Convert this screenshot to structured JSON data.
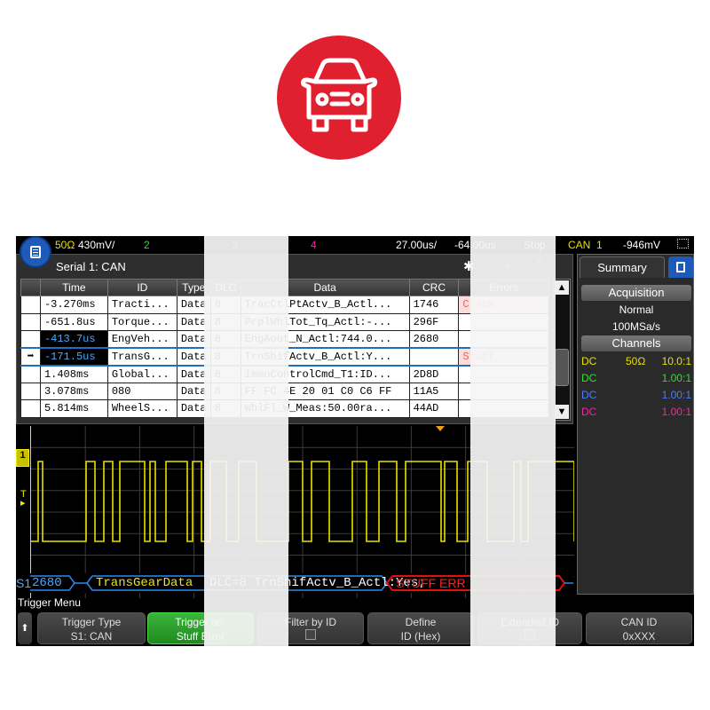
{
  "logo": {
    "icon": "car-icon",
    "color": "#e0202e"
  },
  "topbar": {
    "ch1_imp": "50Ω",
    "ch1_scale": "430mV/",
    "ch2": "2",
    "ch3": "3",
    "ch4": "4",
    "timebase": "27.00us/",
    "delay": "-64.00us",
    "run_state": "Stop",
    "trigger_type": "CAN",
    "trigger_source": "1",
    "trigger_level": "-946mV"
  },
  "serial": {
    "title": "Serial 1: CAN",
    "columns": [
      "",
      "Time",
      "ID",
      "Type",
      "DLC",
      "Data",
      "CRC",
      "Errors"
    ],
    "rows": [
      {
        "marker": "",
        "time": "-3.270ms",
        "id": "Tracti...",
        "type": "Data",
        "dlc": "8",
        "data": "TracCtlPtActv_B_Actl...",
        "crc": "1746",
        "errors": "C,Ack"
      },
      {
        "marker": "",
        "time": "-651.8us",
        "id": "Torque...",
        "type": "Data",
        "dlc": "8",
        "data": "PrplWhlTot_Tq_Actl:-...",
        "crc": "296F",
        "errors": ""
      },
      {
        "marker": "",
        "time": "-413.7us",
        "id": "EngVeh...",
        "type": "Data",
        "dlc": "8",
        "data": "EngAout_N_Actl:744.0...",
        "crc": "2680",
        "errors": ""
      },
      {
        "marker": "➡",
        "time": "-171.5us",
        "id": "TransG...",
        "type": "Data",
        "dlc": "8",
        "data": "TrnShifActv_B_Actl:Y...",
        "crc": "",
        "errors": "Stuff"
      },
      {
        "marker": "",
        "time": "1.408ms",
        "id": "Global...",
        "type": "Data",
        "dlc": "8",
        "data": "immoControlCmd_T1:ID...",
        "crc": "2D8D",
        "errors": ""
      },
      {
        "marker": "",
        "time": "3.078ms",
        "id": "080",
        "type": "Data",
        "dlc": "8",
        "data": "FF FC 4E 20 01 C0 C6 FF",
        "crc": "11A5",
        "errors": ""
      },
      {
        "marker": "",
        "time": "5.814ms",
        "id": "WheelS...",
        "type": "Data",
        "dlc": "8",
        "data": "WhlFl_W_Meas:50.00ra...",
        "crc": "44AD",
        "errors": ""
      }
    ]
  },
  "decode": {
    "label": "S1",
    "crc_prev": "2680",
    "frame_name": "TransGearData",
    "frame_data": "DLC=8 TrnShifActv_B_Actl:Yes;",
    "error": "STUFF ERR"
  },
  "summary": {
    "tab": "Summary",
    "acq_header": "Acquisition",
    "acq_mode": "Normal",
    "sample_rate": "100MSa/s",
    "ch_header": "Channels",
    "channels": [
      {
        "coupling": "DC",
        "imp": "50Ω",
        "probe": "10.0:1",
        "color": "#e8e000"
      },
      {
        "coupling": "DC",
        "imp": "",
        "probe": "1.00:1",
        "color": "#33dd33"
      },
      {
        "coupling": "DC",
        "imp": "",
        "probe": "1.00:1",
        "color": "#4a7cff"
      },
      {
        "coupling": "DC",
        "imp": "",
        "probe": "1.00:1",
        "color": "#ee2aa0"
      }
    ]
  },
  "trigger_menu": {
    "title": "Trigger Menu",
    "softkeys": [
      {
        "line1": "Trigger Type",
        "line2": "S1: CAN"
      },
      {
        "line1": "Trigger on:",
        "line2": "Stuff Error"
      },
      {
        "line1": "Filter by ID",
        "line2": ""
      },
      {
        "line1": "Define",
        "line2": "ID (Hex)"
      },
      {
        "line1": "Extended ID",
        "line2": ""
      },
      {
        "line1": "CAN ID",
        "line2": "0xXXX"
      }
    ]
  }
}
